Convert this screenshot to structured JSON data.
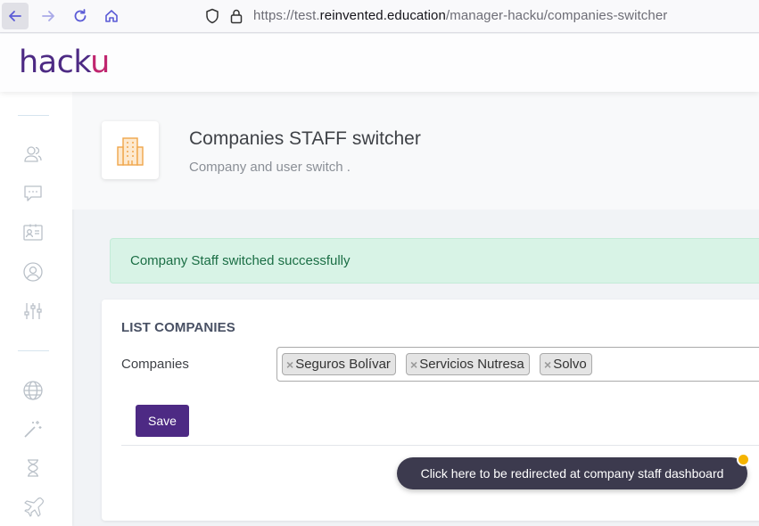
{
  "browser": {
    "url_prefix": "https://test.",
    "url_host": "reinvented.education",
    "url_path": "/manager-hacku/companies-switcher",
    "icons": [
      "back-icon",
      "forward-icon",
      "reload-icon",
      "home-icon",
      "shield-icon",
      "lock-icon"
    ]
  },
  "app": {
    "logo_main": "hack",
    "logo_accent": "u",
    "colors": {
      "brand": "#4d2a84",
      "accent": "#c0266f"
    }
  },
  "sidebar": {
    "items": [
      {
        "icon": "users-icon"
      },
      {
        "icon": "chat-icon"
      },
      {
        "icon": "id-card-icon"
      },
      {
        "icon": "user-circle-icon"
      },
      {
        "icon": "sliders-icon"
      },
      {
        "icon": "globe-icon"
      },
      {
        "icon": "magic-wand-icon"
      },
      {
        "icon": "hourglass-icon"
      },
      {
        "icon": "plane-icon"
      }
    ]
  },
  "page": {
    "title": "Companies STAFF switcher",
    "subtitle": "Company and user switch .",
    "icon": "building-icon"
  },
  "alert": {
    "message": "Company Staff switched successfully",
    "color": "#d8f3e6"
  },
  "card": {
    "title": "LIST COMPANIES",
    "field_label": "Companies",
    "selected": [
      {
        "remove": "×",
        "label": "Seguros Bolívar"
      },
      {
        "remove": "×",
        "label": "Servicios Nutresa"
      },
      {
        "remove": "×",
        "label": "Solvo"
      }
    ],
    "save_label": "Save"
  },
  "tooltip": {
    "text": "Click here to be redirected at company staff dashboard",
    "dot_color": "#f5b400"
  }
}
